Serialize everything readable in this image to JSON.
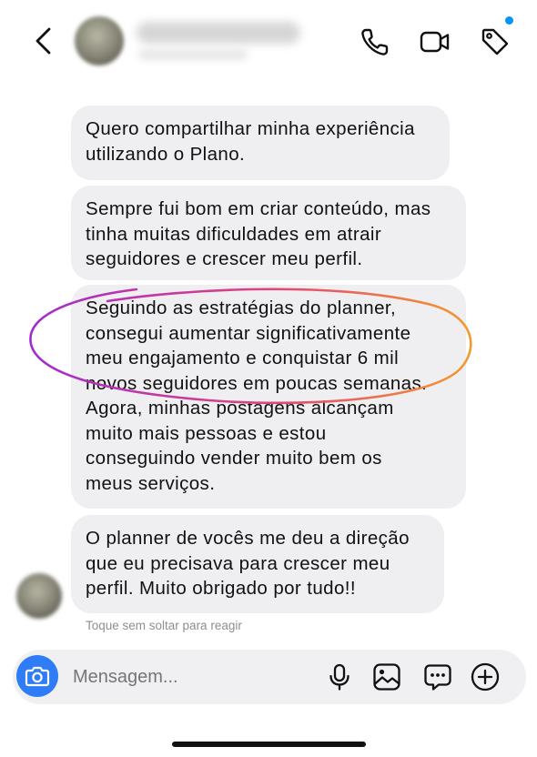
{
  "header": {
    "back_icon": "chevron-left-icon",
    "icons": [
      "phone-icon",
      "video-camera-icon",
      "tag-icon"
    ],
    "accent_color": "#0095f6"
  },
  "messages": [
    {
      "lines": [
        "Quero compartilhar minha experiência",
        "utilizando o Plano."
      ]
    },
    {
      "lines": [
        "Sempre fui bom em criar conteúdo, mas",
        "tinha muitas dificuldades em atrair",
        "seguidores e crescer meu perfil."
      ]
    },
    {
      "lines": [
        "Seguindo as estratégias do planner,",
        "consegui aumentar significativamente",
        "meu engajamento e conquistar 6 mil",
        "novos seguidores em poucas semanas.",
        "Agora, minhas postagens alcançam",
        "muito mais pessoas e estou",
        "conseguindo vender muito bem os",
        "meus serviços."
      ]
    },
    {
      "lines": [
        "O planner de vocês me deu a direção",
        "que eu precisava para crescer meu",
        "perfil. Muito obrigado por tudo!!"
      ]
    }
  ],
  "hint": "Toque sem soltar para reagir",
  "composer": {
    "placeholder": "Mensagem...",
    "camera_color": "#2f7df6",
    "icons": [
      "microphone-icon",
      "image-icon",
      "sticker-icon",
      "plus-icon"
    ]
  },
  "annotation": {
    "colors": [
      "#a12bd1",
      "#e0457a",
      "#f39a2e"
    ]
  }
}
